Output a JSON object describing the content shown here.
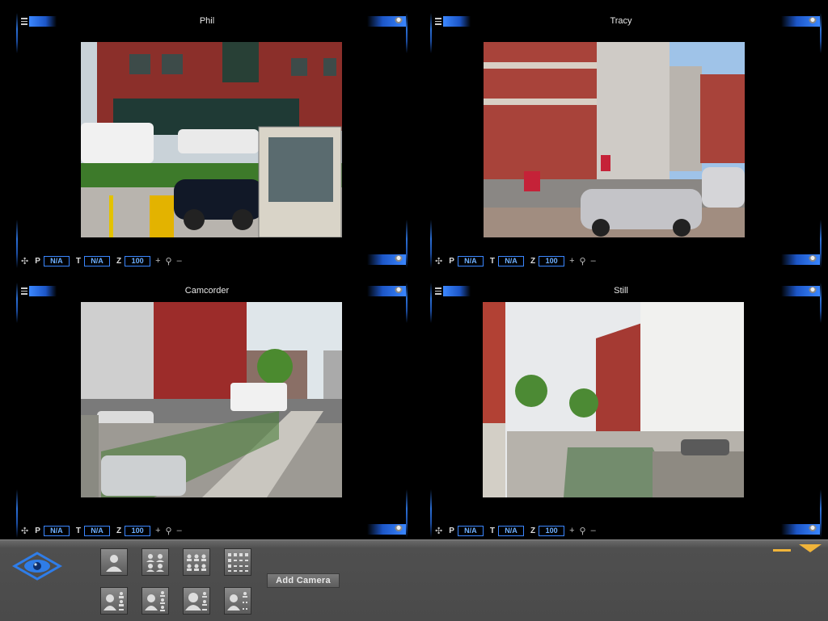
{
  "cameras": [
    {
      "title": "Phil",
      "pan": "N/A",
      "tilt": "N/A",
      "zoom": "100"
    },
    {
      "title": "Tracy",
      "pan": "N/A",
      "tilt": "N/A",
      "zoom": "100"
    },
    {
      "title": "Camcorder",
      "pan": "N/A",
      "tilt": "N/A",
      "zoom": "100"
    },
    {
      "title": "Still",
      "pan": "N/A",
      "tilt": "N/A",
      "zoom": "100"
    }
  ],
  "ptz_labels": {
    "pan": "P",
    "tilt": "T",
    "zoom": "Z",
    "zoom_in": "+",
    "zoom_out": "–"
  },
  "toolbar": {
    "add_camera_label": "Add Camera",
    "layouts": [
      "single-view",
      "quad-view",
      "six-view",
      "grid-view",
      "one-plus-three-view",
      "one-plus-five-view",
      "one-plus-seven-view",
      "custom-view"
    ]
  },
  "colors": {
    "accent_blue": "#3b87ff",
    "toolbar_gray": "#4a4a4a",
    "window_control": "#f0b43a"
  }
}
